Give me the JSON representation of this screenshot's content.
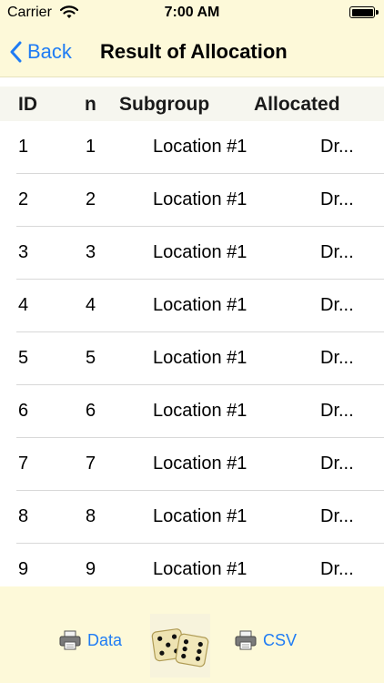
{
  "status": {
    "carrier": "Carrier",
    "time": "7:00 AM"
  },
  "nav": {
    "back_label": "Back",
    "title": "Result of Allocation"
  },
  "table": {
    "headers": {
      "id": "ID",
      "n": "n",
      "subgroup": "Subgroup",
      "allocated": "Allocated"
    },
    "rows": [
      {
        "id": "1",
        "n": "1",
        "subgroup": "Location #1",
        "allocated": "Dr..."
      },
      {
        "id": "2",
        "n": "2",
        "subgroup": "Location #1",
        "allocated": "Dr..."
      },
      {
        "id": "3",
        "n": "3",
        "subgroup": "Location #1",
        "allocated": "Dr..."
      },
      {
        "id": "4",
        "n": "4",
        "subgroup": "Location #1",
        "allocated": "Dr..."
      },
      {
        "id": "5",
        "n": "5",
        "subgroup": "Location #1",
        "allocated": "Dr..."
      },
      {
        "id": "6",
        "n": "6",
        "subgroup": "Location #1",
        "allocated": "Dr..."
      },
      {
        "id": "7",
        "n": "7",
        "subgroup": "Location #1",
        "allocated": "Dr..."
      },
      {
        "id": "8",
        "n": "8",
        "subgroup": "Location #1",
        "allocated": "Dr..."
      },
      {
        "id": "9",
        "n": "9",
        "subgroup": "Location #1",
        "allocated": "Dr..."
      }
    ]
  },
  "toolbar": {
    "data_label": "Data",
    "csv_label": "CSV",
    "dice_icon": "dice-icon"
  },
  "colors": {
    "accent": "#1f7cf4",
    "bar_background": "#fdf9d9",
    "header_background": "#f6f6ef"
  }
}
